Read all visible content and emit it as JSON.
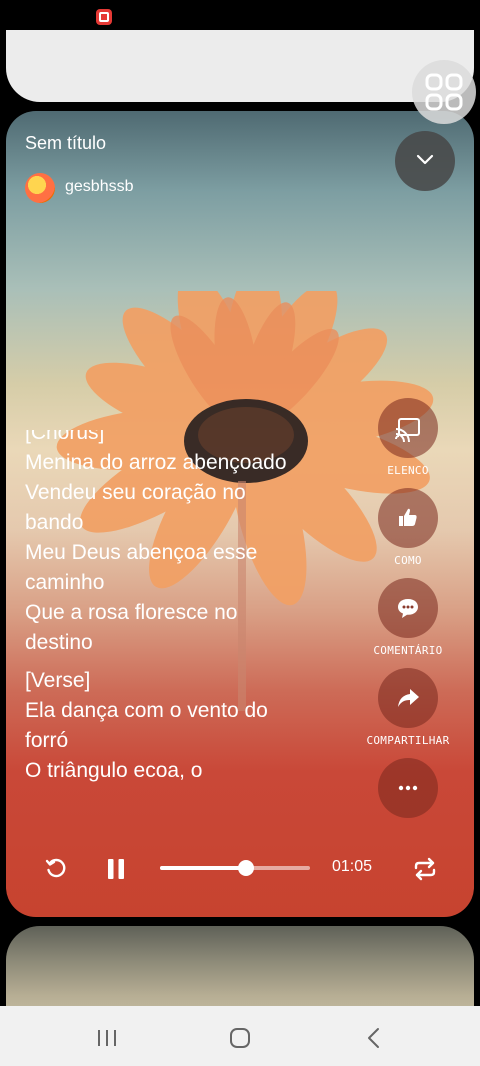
{
  "song": {
    "title": "Sem título",
    "author": "gesbhssb"
  },
  "lyrics": {
    "cut_line": "[Chorus]",
    "lines_1": [
      "Menina do arroz abençoado",
      "Vendeu seu coração no",
      "bando",
      "Meu Deus abençoa esse",
      "caminho",
      "Que a rosa floresce no",
      "destino"
    ],
    "lines_2": [
      "[Verse]",
      "Ela dança com o vento do",
      "forró",
      "O triângulo ecoa, o"
    ]
  },
  "actions": {
    "cast": {
      "label": "ELENCO",
      "icon": "cast-icon"
    },
    "like": {
      "label": "COMO",
      "icon": "thumbs-up-icon"
    },
    "comment": {
      "label": "COMENTÁRIO",
      "icon": "comment-icon"
    },
    "share": {
      "label": "COMPARTILHAR",
      "icon": "share-icon"
    },
    "more": {
      "icon": "more-horizontal-icon"
    }
  },
  "player": {
    "time": "01:05",
    "progress": 0.57
  },
  "colors": {
    "accent": "#c7432f",
    "text": "#ffffff"
  }
}
